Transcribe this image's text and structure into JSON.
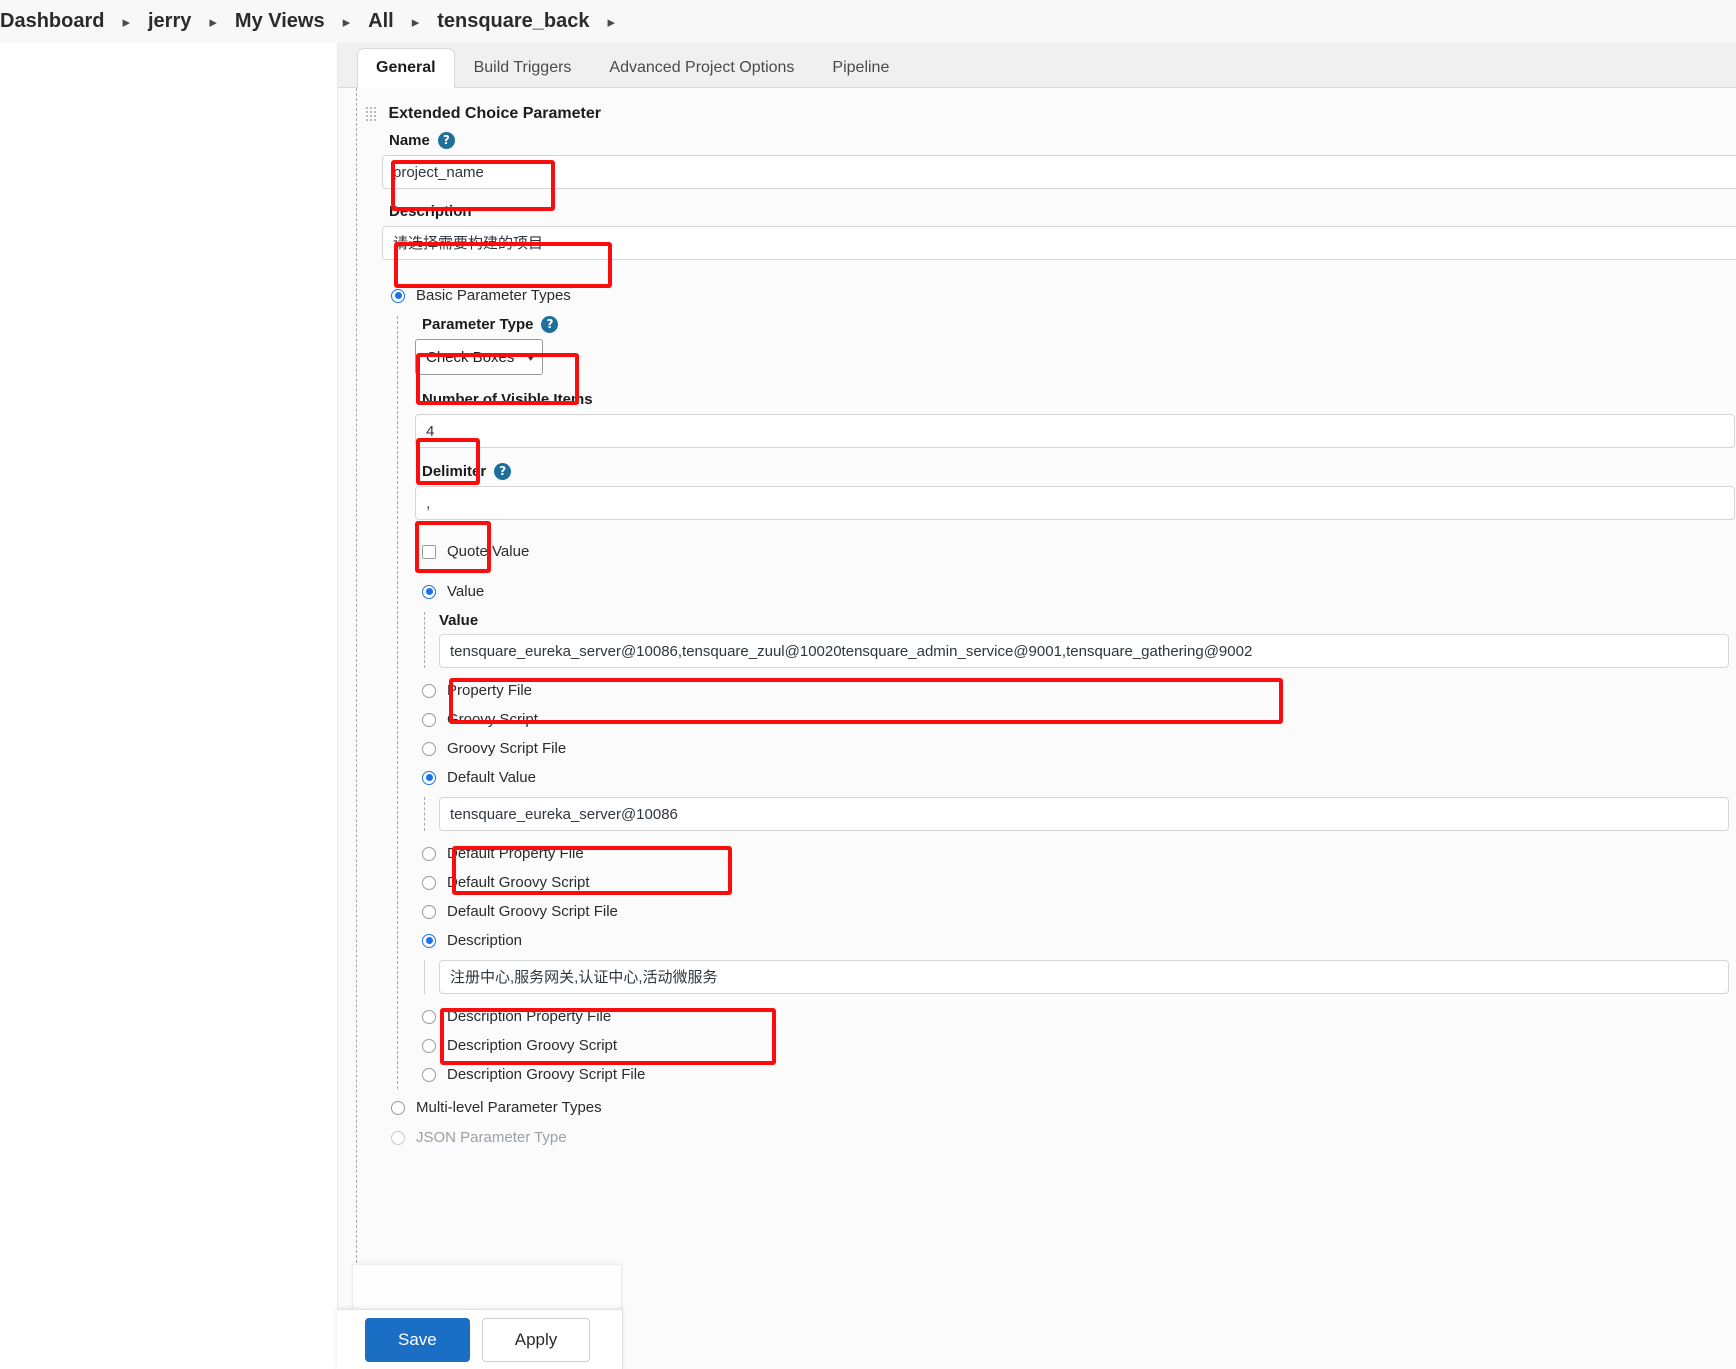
{
  "breadcrumb": {
    "items": [
      {
        "label": "Dashboard"
      },
      {
        "label": "jerry"
      },
      {
        "label": "My Views"
      },
      {
        "label": "All"
      },
      {
        "label": "tensquare_back"
      }
    ],
    "separator": "▸"
  },
  "tabs": [
    {
      "label": "General",
      "active": true
    },
    {
      "label": "Build Triggers",
      "active": false
    },
    {
      "label": "Advanced Project Options",
      "active": false
    },
    {
      "label": "Pipeline",
      "active": false
    }
  ],
  "parameter": {
    "section_title": "Extended Choice Parameter",
    "name": {
      "label": "Name",
      "help_icon": "help-icon",
      "value": "project_name"
    },
    "description": {
      "label": "Description",
      "value": "请选择需要构建的项目"
    },
    "basic_types": {
      "label": "Basic Parameter Types",
      "selected": true
    },
    "parameter_type": {
      "label": "Parameter Type",
      "help_icon": "help-icon",
      "selected_option": "Check Boxes",
      "chevron": "⌄"
    },
    "visible_items": {
      "label": "Number of Visible Items",
      "value": "4"
    },
    "delimiter": {
      "label": "Delimiter",
      "help_icon": "help-icon",
      "value": ","
    },
    "quote_value": {
      "label": "Quote Value",
      "checked": false
    },
    "value_source_options": [
      {
        "label": "Value",
        "selected": true
      },
      {
        "label": "Property File",
        "selected": false
      },
      {
        "label": "Groovy Script",
        "selected": false
      },
      {
        "label": "Groovy Script File",
        "selected": false
      }
    ],
    "value_field": {
      "label": "Value",
      "value": "tensquare_eureka_server@10086,tensquare_zuul@10020tensquare_admin_service@9001,tensquare_gathering@9002"
    },
    "default_source_options": [
      {
        "label": "Default Value",
        "selected": true
      },
      {
        "label": "Default Property File",
        "selected": false
      },
      {
        "label": "Default Groovy Script",
        "selected": false
      },
      {
        "label": "Default Groovy Script File",
        "selected": false
      }
    ],
    "default_value_field": {
      "value": "tensquare_eureka_server@10086"
    },
    "description_source_options": [
      {
        "label": "Description",
        "selected": true
      },
      {
        "label": "Description Property File",
        "selected": false
      },
      {
        "label": "Description Groovy Script",
        "selected": false
      },
      {
        "label": "Description Groovy Script File",
        "selected": false
      }
    ],
    "description_value_field": {
      "value": "注册中心,服务网关,认证中心,活动微服务"
    },
    "multi_level": {
      "label": "Multi-level Parameter Types",
      "selected": false
    },
    "json_type": {
      "label": "JSON Parameter Type",
      "selected": false
    }
  },
  "footer": {
    "save_label": "Save",
    "apply_label": "Apply"
  },
  "colors": {
    "accent": "#1a73e8",
    "annotation": "#fb0d0d",
    "primary_button": "#1a6fc4",
    "help_icon": "#1f6f9b"
  }
}
